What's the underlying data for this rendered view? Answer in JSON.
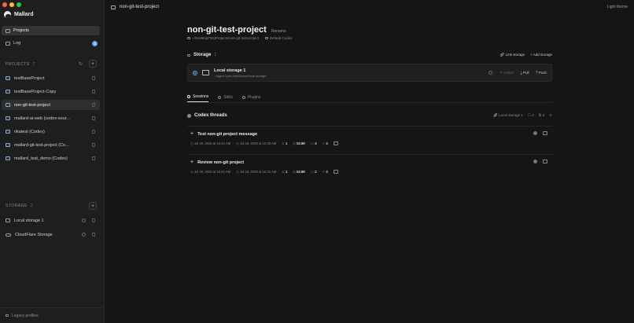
{
  "app": {
    "name": "Mallard",
    "title": "non-git-test-project",
    "theme_label": "Light theme"
  },
  "colors": {
    "traffic_red": "#ff5f57",
    "traffic_yellow": "#febc2e",
    "traffic_green": "#28c840",
    "accent": "#7aa6e6",
    "add": "#5ec27a"
  },
  "sidebar": {
    "nav": [
      {
        "label": "Projects",
        "icon": "folder-icon"
      },
      {
        "label": "Log",
        "icon": "log-icon",
        "badge": "4"
      }
    ],
    "projects_header": "PROJECTS",
    "projects_count": "7",
    "projects": [
      "testBaseProject",
      "testBaseProject-Copy",
      "non-git-test-project",
      "mallard-ai-web (codex-sour...",
      "rikatest (Codex)",
      "mallard-git-test-project (Co...",
      "mallard_test_demo (Codex)"
    ],
    "storage_header": "STORAGE",
    "storage_count": "2",
    "storage": [
      "Local storage 1",
      "CloudFlare Storage"
    ],
    "bottom_label": "Legacy profiles"
  },
  "project": {
    "title": "non-git-test-project",
    "rename": "Rename",
    "path": "~/Desktop/TestProjects/non-git-test-project",
    "agent": "Default Codex",
    "storage_title": "Storage",
    "storage_count": "1",
    "link_storage": "Link storage",
    "add_storage": "Add storage",
    "storage_card": {
      "name": "Local storage 1",
      "path": "~/agent-sync-lakehouse/local-storage",
      "unlink": "Unlink",
      "pull": "Pull",
      "push": "Push"
    },
    "tabs": [
      "Sessions",
      "Skills",
      "Plugins"
    ],
    "threads_title": "Codex threads",
    "threads_filter": "Local storage 1",
    "threads_count_a": "2",
    "threads_count_b": "2",
    "threads": [
      {
        "title": "Test non-git project message",
        "created": "Jul 19, 2026 at 10:42 AM",
        "updated": "Jul 19, 2026 at 10:42 AM",
        "n1": "1",
        "tokens": "52.8K",
        "n2": "3",
        "n3": "2"
      },
      {
        "title": "Review non-git project",
        "created": "Jul 19, 2026 at 10:41 AM",
        "updated": "Jul 19, 2026 at 10:41 AM",
        "n1": "1",
        "tokens": "52.8K",
        "n2": "2",
        "n3": "2"
      }
    ]
  }
}
